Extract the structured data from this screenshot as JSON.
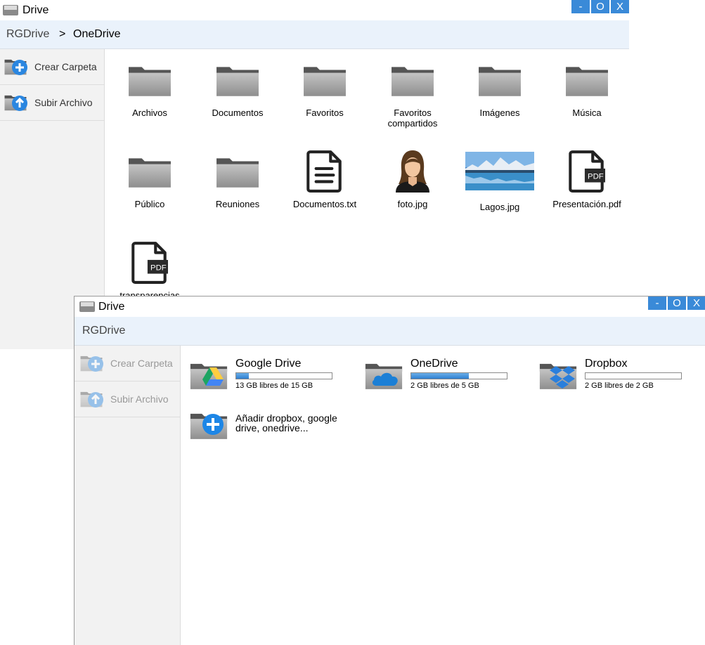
{
  "window1": {
    "title": "Drive",
    "controls": [
      "-",
      "O",
      "X"
    ],
    "breadcrumb": [
      "RGDrive",
      ">",
      "OneDrive"
    ],
    "sidebar": [
      {
        "label": "Crear Carpeta",
        "icon": "folder-plus-icon"
      },
      {
        "label": "Subir Archivo",
        "icon": "folder-upload-icon"
      }
    ],
    "items": [
      {
        "label": "Archivos",
        "icon": "folder-icon"
      },
      {
        "label": "Documentos",
        "icon": "folder-icon"
      },
      {
        "label": "Favoritos",
        "icon": "folder-icon"
      },
      {
        "label": "Favoritos compartidos",
        "icon": "folder-icon"
      },
      {
        "label": "Imágenes",
        "icon": "folder-icon"
      },
      {
        "label": "Música",
        "icon": "folder-icon"
      },
      {
        "label": "Público",
        "icon": "folder-icon"
      },
      {
        "label": "Reuniones",
        "icon": "folder-icon"
      },
      {
        "label": "Documentos.txt",
        "icon": "text-file-icon"
      },
      {
        "label": "foto.jpg",
        "icon": "person-photo-icon"
      },
      {
        "label": "Lagos.jpg",
        "icon": "landscape-photo-icon"
      },
      {
        "label": "Presentación.pdf",
        "icon": "pdf-file-icon"
      },
      {
        "label": "transparencias",
        "icon": "pdf-file-icon"
      }
    ]
  },
  "window2": {
    "title": "Drive",
    "controls": [
      "-",
      "O",
      "X"
    ],
    "breadcrumb": [
      "RGDrive"
    ],
    "sidebar": [
      {
        "label": "Crear Carpeta",
        "icon": "folder-plus-icon",
        "disabled": true
      },
      {
        "label": "Subir Archivo",
        "icon": "folder-upload-icon",
        "disabled": true
      }
    ],
    "drives": [
      {
        "name": "Google Drive",
        "free": "13 GB libres de 15 GB",
        "used_fraction": 0.13,
        "icon": "google-drive-icon"
      },
      {
        "name": "OneDrive",
        "free": "2 GB libres de 5 GB",
        "used_fraction": 0.6,
        "icon": "onedrive-icon"
      },
      {
        "name": "Dropbox",
        "free": "2 GB libres de 2 GB",
        "used_fraction": 0.0,
        "icon": "dropbox-icon"
      }
    ],
    "add": {
      "label": "Añadir dropbox, google drive, onedrive...",
      "icon": "add-account-icon"
    }
  },
  "colors": {
    "accent": "#3a8ad8",
    "breadcrumb_bg": "#eaf2fb",
    "sidebar_bg": "#f2f2f2",
    "folder": "#9a9a9a"
  }
}
